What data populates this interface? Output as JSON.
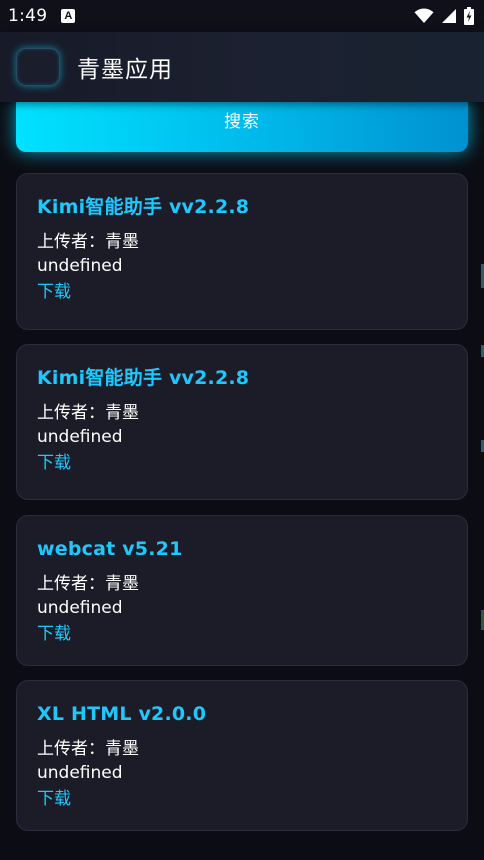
{
  "status_bar": {
    "time": "1:49",
    "notification_icon": "A",
    "icons": [
      "wifi-icon",
      "signal-icon",
      "battery-charging-icon"
    ]
  },
  "app_bar": {
    "title": "青墨应用",
    "logo_icon": "app-logo-icon"
  },
  "search": {
    "label": "搜索"
  },
  "apps": [
    {
      "title": "Kimi智能助手 vv2.2.8",
      "uploader": "上传者：青墨",
      "description": "undefined",
      "download_label": "下载"
    },
    {
      "title": "Kimi智能助手 vv2.2.8",
      "uploader": "上传者：青墨",
      "description": "undefined",
      "download_label": "下载"
    },
    {
      "title": "webcat v5.21",
      "uploader": "上传者：青墨",
      "description": "undefined",
      "download_label": "下载"
    },
    {
      "title": "XL HTML v2.0.0",
      "uploader": "上传者：青墨",
      "description": "undefined",
      "download_label": "下载"
    }
  ],
  "colors": {
    "background": "#0c0d14",
    "card": "#1b1c28",
    "accent": "#1ec8ff",
    "button_start": "#00e2ff",
    "button_end": "#0091d0"
  }
}
